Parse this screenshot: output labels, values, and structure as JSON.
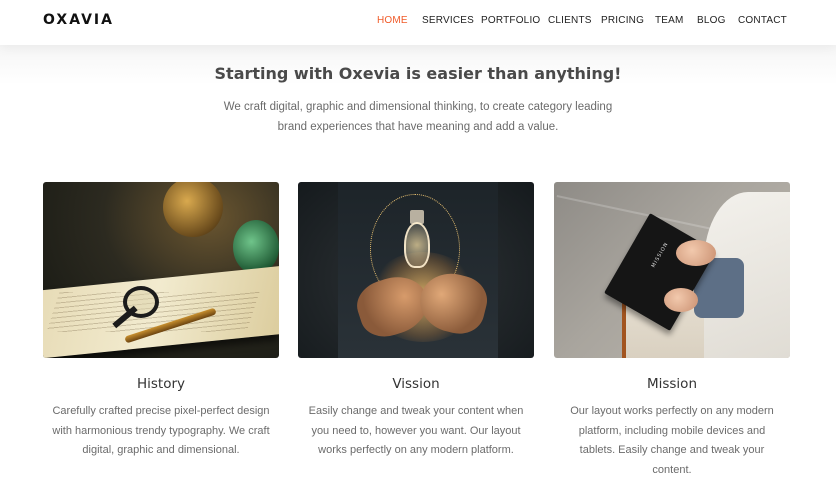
{
  "brand": {
    "logo": "OXAVIA"
  },
  "nav": {
    "items": [
      {
        "label": "HOME",
        "active": true
      },
      {
        "label": "SERVICES",
        "active": false
      },
      {
        "label": "PORTFOLIO",
        "active": false
      },
      {
        "label": "CLIENTS",
        "active": false
      },
      {
        "label": "PRICING",
        "active": false
      },
      {
        "label": "TEAM",
        "active": false
      },
      {
        "label": "BLOG",
        "active": false
      },
      {
        "label": "CONTACT",
        "active": false
      }
    ]
  },
  "intro": {
    "title": "Starting with Oxevia is easier than anything!",
    "text": "We craft digital, graphic and dimensional thinking, to create category leading brand experiences that have meaning and add a value."
  },
  "cards": [
    {
      "title": "History",
      "text": "Carefully crafted precise pixel-perfect design with harmonious trendy typography. We craft digital, graphic and dimensional."
    },
    {
      "title": "Vission",
      "text": "Easily change and tweak your content when you need to, however you want. Our layout works perfectly on any modern platform."
    },
    {
      "title": "Mission",
      "text": "Our layout works perfectly on any modern platform, including mobile devices and tablets. Easily change and tweak your content.",
      "image_book_text": "MISSION"
    }
  ],
  "colors": {
    "accent": "#f05a28",
    "heading": "#4a4a4a",
    "body_text": "#6b6b6b"
  }
}
